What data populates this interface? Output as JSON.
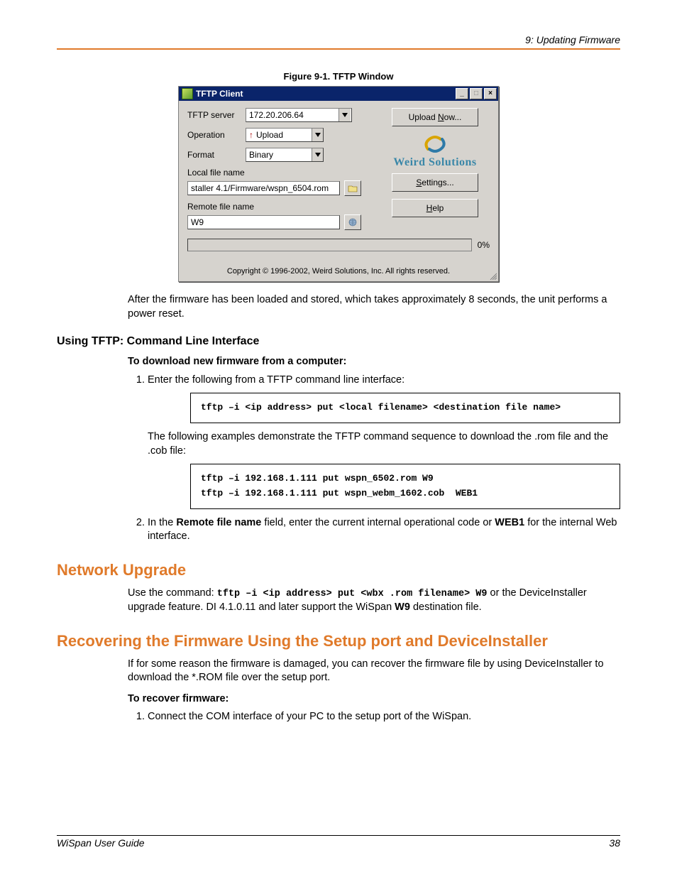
{
  "header": {
    "chapter": "9: Updating Firmware"
  },
  "figure": {
    "caption": "Figure 9-1. TFTP Window"
  },
  "tftp": {
    "title": "TFTP Client",
    "labels": {
      "server": "TFTP server",
      "operation": "Operation",
      "format": "Format",
      "local": "Local file name",
      "remote": "Remote file name"
    },
    "values": {
      "server": "172.20.206.64",
      "operation": "Upload",
      "format": "Binary",
      "local": "staller 4.1/Firmware/wspn_6504.rom",
      "remote": "W9"
    },
    "buttons": {
      "upload": "Upload Now...",
      "settings": "Settings...",
      "help": "Help"
    },
    "logo_text": "Weird Solutions",
    "progress": "0%",
    "copyright": "Copyright © 1996-2002, Weird Solutions, Inc. All rights reserved."
  },
  "text": {
    "after_load": "After the firmware has been loaded and stored, which takes approximately 8 seconds, the unit performs a power reset.",
    "subhead_cli": "Using TFTP: Command Line Interface",
    "lead_download": "To download new firmware from a computer:",
    "step1": "Enter the following from a TFTP command line interface:",
    "code1": "tftp –i <ip address> put <local filename> <destination file name>",
    "after_code1": "The following examples demonstrate the TFTP command sequence to download the .rom file and the .cob file:",
    "code2": "tftp –i 192.168.1.111 put wspn_6502.rom W9\ntftp –i 192.168.1.111 put wspn_webm_1602.cob  WEB1",
    "step2_a": "In the ",
    "step2_b": "Remote file name",
    "step2_c": " field, enter the current internal operational code or ",
    "step2_d": "WEB1",
    "step2_e": " for the internal Web interface.",
    "h2_network": "Network Upgrade",
    "net_a": "Use the command: ",
    "net_code": "tftp –i <ip address> put <wbx .rom filename> W9",
    "net_b": " or the DeviceInstaller upgrade feature. DI 4.1.0.11 and later support the WiSpan ",
    "net_c": "W9",
    "net_d": " destination file.",
    "h2_recover": "Recovering the Firmware Using the Setup port and DeviceInstaller",
    "recover_p": "If for some reason the firmware is damaged, you can recover the firmware file by using DeviceInstaller to download the *.ROM file over the setup port.",
    "lead_recover": "To recover firmware:",
    "recover_step1": "Connect the COM interface of your PC to the setup port of the WiSpan."
  },
  "footer": {
    "left": "WiSpan User Guide",
    "right": "38"
  }
}
